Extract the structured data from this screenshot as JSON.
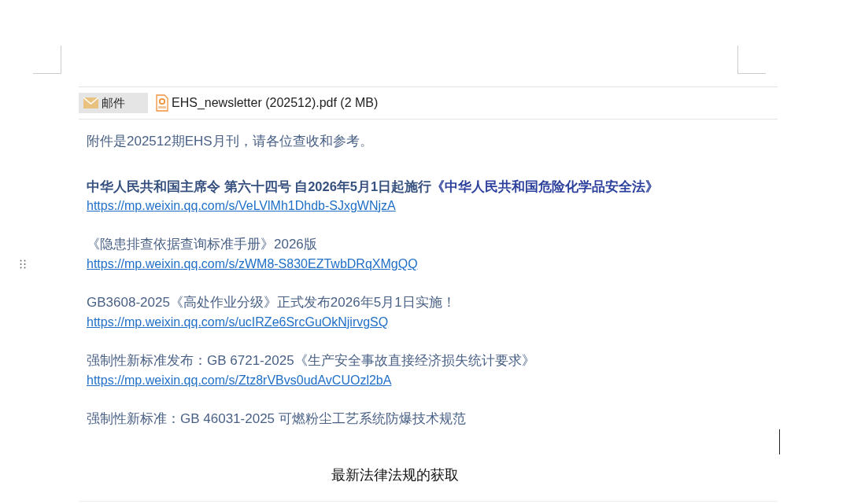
{
  "attachments_bar": {
    "mail_tab": "邮件",
    "file": "EHS_newsletter (202512).pdf (2 MB)"
  },
  "intro": "附件是202512期EHS月刊，请各位查收和参考。",
  "items": [
    {
      "kind": "headline",
      "text": "中华人民共和国主席令 第六十四号 自2026年5月1日起施行",
      "highlight": "《中华人民共和国危险化学品安全法》",
      "link": "https://mp.weixin.qq.com/s/VeLVlMh1Dhdb-SJxgWNjzA"
    },
    {
      "kind": "plain",
      "text": "《隐患排查依据查询标准手册》2026版",
      "link": "https://mp.weixin.qq.com/s/zWM8-S830EZTwbDRqXMgQQ"
    },
    {
      "kind": "plain",
      "text": "GB3608-2025《高处作业分级》正式发布2026年5月1日实施！",
      "link": "https://mp.weixin.qq.com/s/ucIRZe6SrcGuOkNjirvgSQ"
    },
    {
      "kind": "plain",
      "text": "强制性新标准发布：GB 6721-2025《生产安全事故直接经济损失统计要求》",
      "link": "https://mp.weixin.qq.com/s/Ztz8rVBvs0udAvCUOzl2bA"
    },
    {
      "kind": "plain",
      "text": "强制性新标准：GB 46031-2025 可燃粉尘工艺系统防爆技术规范"
    }
  ],
  "caption": "最新法律法规的获取"
}
